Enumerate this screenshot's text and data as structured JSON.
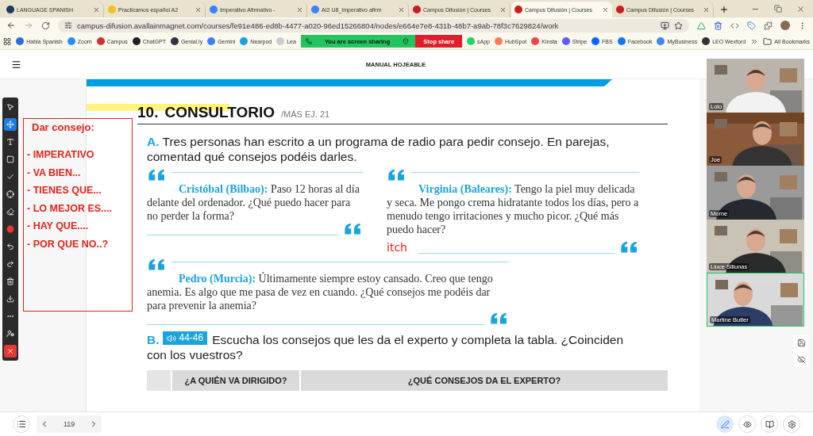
{
  "browser": {
    "tabs": [
      {
        "title": "LANGUAGE SPANISH",
        "selected": false
      },
      {
        "title": "Practicamos español A2",
        "selected": false
      },
      {
        "title": "Imperativo Afirmativo -",
        "selected": false
      },
      {
        "title": "AI2 U8_Imperativo afirm",
        "selected": false
      },
      {
        "title": "Campus Difusión | Courses",
        "selected": false
      },
      {
        "title": "Campus Difusión | Courses",
        "selected": true
      },
      {
        "title": "Campus Difusión | Courses",
        "selected": false
      }
    ],
    "url": "campus-difusion.avallainmagnet.com/courses/fe91e486-ed8b-4477-a020-96ed15266804/nodes/e664e7e8-431b-48b7-a9ab-78f3c7629824/work",
    "bookmarks": [
      "Habla Spanish",
      "Zoom",
      "Campus",
      "ChatGPT",
      "Genial.ly",
      "Gemini",
      "Nearpod",
      "Lea"
    ],
    "sharing_bar": {
      "status": "You are screen sharing",
      "stop_button": "Stop share"
    },
    "bookmarks_more": [
      "sApp",
      "HubSpot",
      "Kinsta",
      "Stripe",
      "FBS",
      "Facebook",
      "MyBusiness",
      "LEO Wexford"
    ],
    "all_bookmarks": "All Bookmarks"
  },
  "app": {
    "title": "MANUAL HOJEABLE",
    "tools": [
      {
        "selected": false
      },
      {
        "selected": true
      },
      {
        "selected": false
      },
      {
        "selected": false
      },
      {
        "selected": false
      },
      {
        "selected": false
      },
      {
        "selected": false
      },
      {
        "selected": false
      },
      {
        "selected": false
      },
      {
        "selected": false
      },
      {
        "selected": false
      },
      {
        "selected": false
      },
      {
        "selected": false
      },
      {
        "selected": false
      },
      {
        "selected": false
      }
    ],
    "note": {
      "title": "Dar consejo:",
      "items": [
        "- IMPERATIVO",
        "- VA BIEN...",
        "- TIENES QUE...",
        "- LO MEJOR ES....",
        "- HAY QUE....",
        "- POR QUE NO..?"
      ]
    },
    "exercise": {
      "number": "10.",
      "title": "CONSULTORIO",
      "reference": "/MÁS EJ. 21",
      "section_a": {
        "letter": "A.",
        "instruction": "Tres personas han escrito a un programa de radio para pedir consejo. En parejas, comentad qué consejos podéis darles."
      },
      "quotes": [
        {
          "speaker": "Cristóbal (Bilbao):",
          "text": "Paso 12 horas al día delante del ordenador. ¿Qué puedo hacer para no perder la forma?"
        },
        {
          "speaker": "Virginia (Baleares):",
          "text": "Tengo la piel muy delicada y seca. Me pongo crema hidratante todos los días, pero a menudo tengo irritaciones y mucho picor. ¿Qué más puedo hacer?",
          "annotation": "itch"
        },
        {
          "speaker": "Pedro (Murcia):",
          "text": "Últimamente siempre estoy cansado. Creo que tengo anemia. Es algo que me pasa de vez en cuando. ¿Qué consejos me podéis dar para prevenir la anemia?"
        }
      ],
      "section_b": {
        "letter": "B.",
        "audio": "44-46",
        "instruction": "Escucha los consejos que les da el experto y completa la tabla. ¿Coinciden con los vuestros?"
      },
      "table_columns": [
        "¿A QUIÉN VA DIRIGIDO?",
        "¿QUÉ CONSEJOS DA EL EXPERTO?"
      ]
    },
    "participants": [
      {
        "name": "Lolo",
        "speaking": false
      },
      {
        "name": "Joe",
        "speaking": false
      },
      {
        "name": "Morne",
        "speaking": false
      },
      {
        "name": "Liuce Siliunas",
        "speaking": false
      },
      {
        "name": "Martine Butler",
        "speaking": true
      }
    ],
    "page": "119",
    "view_buttons": [
      {
        "selected": true
      },
      {
        "selected": false
      },
      {
        "selected": false
      },
      {
        "selected": false
      }
    ]
  }
}
